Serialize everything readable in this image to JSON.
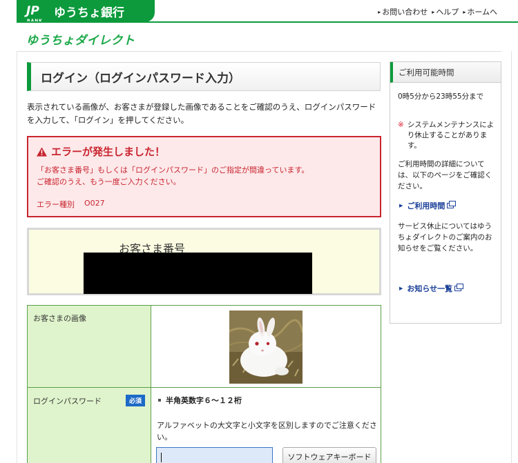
{
  "header": {
    "logo_mark": "JP",
    "logo_small": "BANK",
    "brand_name": "ゆうちょ銀行",
    "sub_brand": "ゆうちょダイレクト",
    "links": [
      "お問い合わせ",
      "ヘルプ",
      "ホームへ"
    ]
  },
  "page": {
    "title": "ログイン（ログインパスワード入力）",
    "intro": "表示されている画像が、お客さまが登録した画像であることをご確認のうえ、ログインパスワードを入力して、「ログイン」を押してください。"
  },
  "error": {
    "title": "エラーが発生しました！",
    "line1": "「お客さま番号」もしくは「ログインパスワード」のご指定が間違っています。",
    "line2": "ご確認のうえ、もう一度ご入力ください。",
    "code_label": "エラー種別",
    "code_value": "O027"
  },
  "customer": {
    "label": "お客さま番号"
  },
  "form": {
    "image_label": "お客さまの画像",
    "password_label": "ログインパスワード",
    "required_badge": "必須",
    "password_rule": "半角英数字６～１２桁",
    "password_note": "アルファベットの大文字と小文字を区別しますのでご注意ください。",
    "password_value": "",
    "software_keyboard_label": "ソフトウェアキーボード"
  },
  "sidebar": {
    "heading": "ご利用可能時間",
    "hours": "0時5分から23時55分まで",
    "note_mark": "※",
    "note": "システムメンテナンスにより休止することがあります。",
    "detail_text": "ご利用時間の詳細については、以下のページをご確認ください。",
    "link_hours": "ご利用時間",
    "service_text": "サービス休止についてはゆうちょダイレクトのご案内のお知らせをご覧ください。",
    "link_news": "お知らせ一覧"
  },
  "colors": {
    "brand_green": "#0c9a3c",
    "error_red": "#c8242f",
    "link_blue": "#1a3f99"
  }
}
